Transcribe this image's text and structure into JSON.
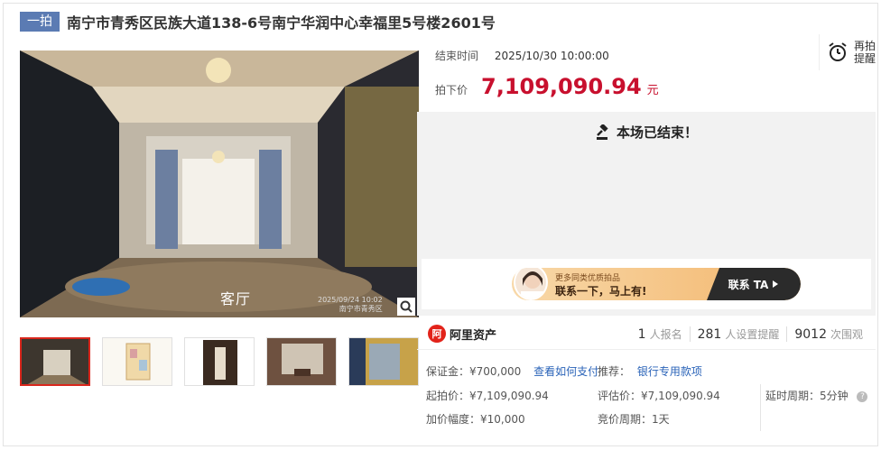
{
  "title": {
    "badge": "一拍",
    "text": "南宁市青秀区民族大道138-6号南宁华润中心幸福里5号楼2601号"
  },
  "gallery": {
    "caption": "客厅",
    "stamp_line1": "2025/09/24 10:02",
    "stamp_line2": "南宁市青秀区",
    "thumbnails": [
      "living-room",
      "floor-plan",
      "hallway",
      "dining-area",
      "window-view"
    ]
  },
  "auction": {
    "end_label": "结束时间",
    "end_time": "2025/10/30 10:00:00",
    "price_label": "拍下价",
    "price": "7,109,090.94",
    "unit": "元",
    "remind_line1": "再拍",
    "remind_line2": "提醒",
    "ended_text": "本场已结束！"
  },
  "banner": {
    "line1": "更多同类优质拍品",
    "line2": "联系一下，马上有!",
    "cta": "联系 TA"
  },
  "platform": {
    "logo_char": "阿",
    "name": "阿里资产"
  },
  "stats": [
    {
      "num": "1",
      "label": "人报名"
    },
    {
      "num": "281",
      "label": "人设置提醒"
    },
    {
      "num": "9012",
      "label": "次围观"
    }
  ],
  "details": {
    "deposit_label": "保证金：",
    "deposit_value": "¥700,000",
    "deposit_link": "查看如何支付",
    "recommend_label": "推荐：",
    "recommend_link": "银行专用款项",
    "start_label": "起拍价：",
    "start_value": "¥7,109,090.94",
    "appraise_label": "评估价：",
    "appraise_value": "¥7,109,090.94",
    "delay_label": "延时周期：",
    "delay_value": "5分钟",
    "increment_label": "加价幅度：",
    "increment_value": "¥10,000",
    "period_label": "竞价周期：",
    "period_value": "1天"
  },
  "colors": {
    "accent": "#c8102e",
    "badge": "#5b7bb3",
    "link": "#2a63b8"
  }
}
